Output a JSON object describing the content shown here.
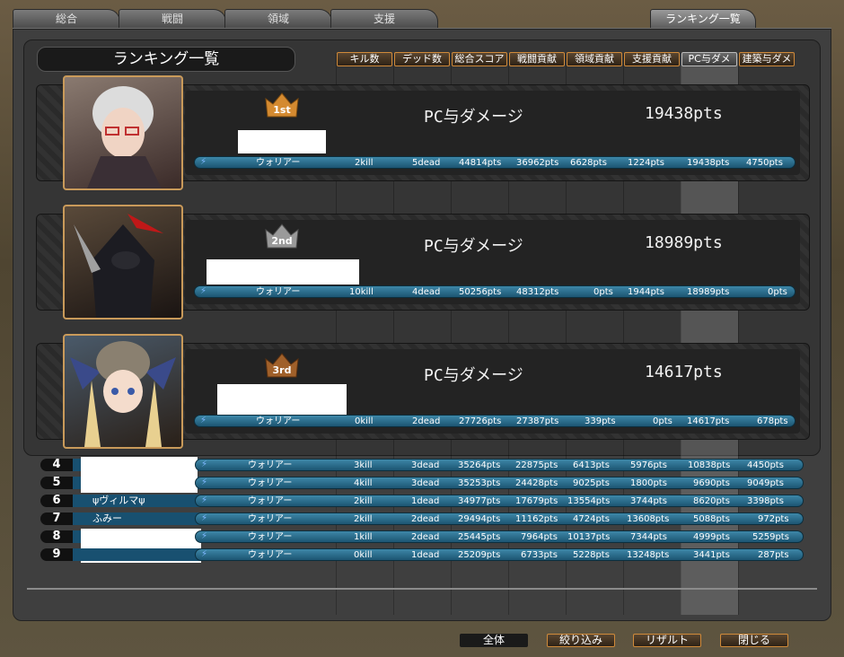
{
  "tabs": [
    "総合",
    "戦闘",
    "領域",
    "支援",
    "ランキング一覧"
  ],
  "window_title": "ランキング一覧",
  "sort_buttons": [
    "キル数",
    "デッド数",
    "総合スコア",
    "戦闘貢献",
    "領域貢献",
    "支援貢献",
    "PC与ダメ",
    "建築与ダメ"
  ],
  "top3": [
    {
      "rank": "1st",
      "metric": "PC与ダメージ",
      "pts": "19438pts",
      "class": "ウォリアー",
      "kill": "2kill",
      "dead": "5dead",
      "total": "44814pts",
      "battle": "36962pts",
      "area": "6628pts",
      "support": "1224pts",
      "pcdmg": "19438pts",
      "build": "4750pts"
    },
    {
      "rank": "2nd",
      "metric": "PC与ダメージ",
      "pts": "18989pts",
      "class": "ウォリアー",
      "kill": "10kill",
      "dead": "4dead",
      "total": "50256pts",
      "battle": "48312pts",
      "area": "0pts",
      "support": "1944pts",
      "pcdmg": "18989pts",
      "build": "0pts"
    },
    {
      "rank": "3rd",
      "metric": "PC与ダメージ",
      "pts": "14617pts",
      "class": "ウォリアー",
      "kill": "0kill",
      "dead": "2dead",
      "total": "27726pts",
      "battle": "27387pts",
      "area": "339pts",
      "support": "0pts",
      "pcdmg": "14617pts",
      "build": "678pts"
    }
  ],
  "rows": [
    {
      "num": "4",
      "name": "",
      "class": "ウォリアー",
      "kill": "3kill",
      "dead": "3dead",
      "total": "35264pts",
      "battle": "22875pts",
      "area": "6413pts",
      "support": "5976pts",
      "pcdmg": "10838pts",
      "build": "4450pts"
    },
    {
      "num": "5",
      "name": "",
      "class": "ウォリアー",
      "kill": "4kill",
      "dead": "3dead",
      "total": "35253pts",
      "battle": "24428pts",
      "area": "9025pts",
      "support": "1800pts",
      "pcdmg": "9690pts",
      "build": "9049pts"
    },
    {
      "num": "6",
      "name": "ψヴィルマψ",
      "class": "ウォリアー",
      "kill": "2kill",
      "dead": "1dead",
      "total": "34977pts",
      "battle": "17679pts",
      "area": "13554pts",
      "support": "3744pts",
      "pcdmg": "8620pts",
      "build": "3398pts"
    },
    {
      "num": "7",
      "name": "ふみー",
      "class": "ウォリアー",
      "kill": "2kill",
      "dead": "2dead",
      "total": "29494pts",
      "battle": "11162pts",
      "area": "4724pts",
      "support": "13608pts",
      "pcdmg": "5088pts",
      "build": "972pts"
    },
    {
      "num": "8",
      "name": "",
      "class": "ウォリアー",
      "kill": "1kill",
      "dead": "2dead",
      "total": "25445pts",
      "battle": "7964pts",
      "area": "10137pts",
      "support": "7344pts",
      "pcdmg": "4999pts",
      "build": "5259pts"
    },
    {
      "num": "9",
      "name": "",
      "class": "ウォリアー",
      "kill": "0kill",
      "dead": "1dead",
      "total": "25209pts",
      "battle": "6733pts",
      "area": "5228pts",
      "support": "13248pts",
      "pcdmg": "3441pts",
      "build": "287pts"
    }
  ],
  "footer": {
    "all": "全体",
    "filter": "絞り込み",
    "result": "リザルト",
    "close": "閉じる"
  }
}
